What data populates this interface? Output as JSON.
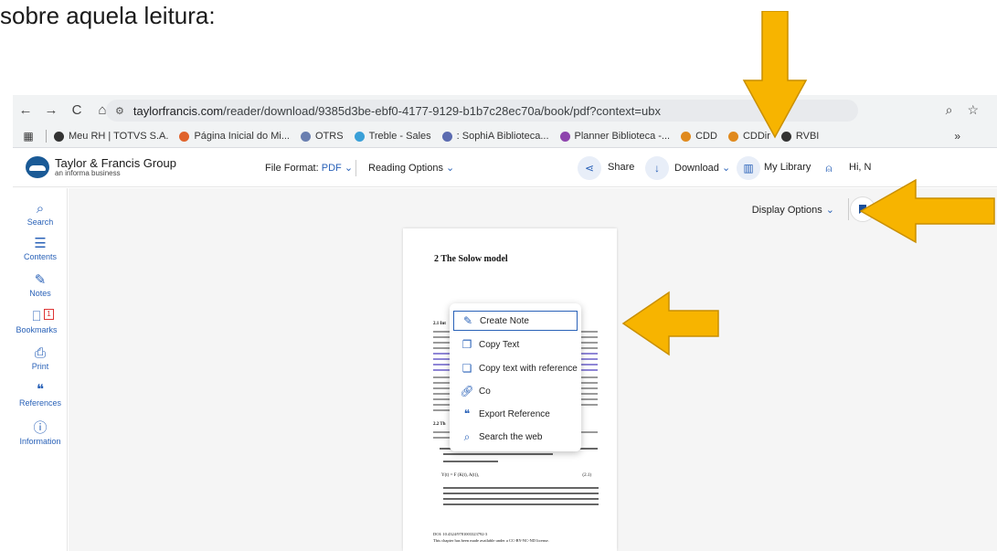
{
  "caption": "sobre aquela leitura:",
  "browser": {
    "url_host": "taylorfrancis.com",
    "url_path": "/reader/download/9385d3be-ebf0-4177-9129-b1b7c28ec70a/book/pdf?context=ubx",
    "bookmarks": [
      {
        "label": "Meu RH | TOTVS S.A.",
        "color": "#333333"
      },
      {
        "label": "Página Inicial do Mi...",
        "color": "#e0632b"
      },
      {
        "label": "OTRS",
        "color": "#6a7fb0"
      },
      {
        "label": "Treble - Sales",
        "color": "#3aa0d8"
      },
      {
        "label": ": SophiA Biblioteca...",
        "color": "#5b6bb0"
      },
      {
        "label": "Planner Biblioteca -...",
        "color": "#8e44ad"
      },
      {
        "label": "CDD",
        "color": "#e08a1e"
      },
      {
        "label": "CDDir",
        "color": "#e08a1e"
      },
      {
        "label": "RVBI",
        "color": "#333333"
      }
    ],
    "more": "»"
  },
  "header": {
    "brand": "Taylor & Francis Group",
    "brand_sub": "an informa business",
    "file_format_label": "File Format:",
    "file_format_value": "PDF",
    "reading_options": "Reading Options",
    "share": "Share",
    "download": "Download",
    "my_library": "My Library",
    "greeting": "Hi, N"
  },
  "sidebar": {
    "items": [
      {
        "label": "Search",
        "icon": "search-icon"
      },
      {
        "label": "Contents",
        "icon": "list-icon"
      },
      {
        "label": "Notes",
        "icon": "note-icon"
      },
      {
        "label": "Bookmarks",
        "icon": "bookmark-icon",
        "badge": "1"
      },
      {
        "label": "Print",
        "icon": "print-icon"
      },
      {
        "label": "References",
        "icon": "quote-icon"
      },
      {
        "label": "Information",
        "icon": "info-icon"
      }
    ]
  },
  "toolbar": {
    "display_options": "Display Options"
  },
  "pdf": {
    "chapter_title": "2   The Solow model",
    "section_1": "2.1  Int",
    "section_2": "2.2  Th",
    "equation": "Y(t) = F (K(t), A(t)),",
    "equation_number": "(2.1)",
    "doi": "DOI: 10.4324/9781003323792-3",
    "license": "This chapter has been made available under a CC-BY-NC-ND license."
  },
  "context_menu": {
    "items": [
      {
        "label": "Create Note",
        "icon": "edit-note-icon"
      },
      {
        "label": "Copy Text",
        "icon": "copy-icon"
      },
      {
        "label": "Copy text with reference",
        "icon": "copy-reference-icon"
      },
      {
        "label": "Co",
        "icon": "link-icon"
      },
      {
        "label": "Export Reference",
        "icon": "quote-icon"
      },
      {
        "label": "Search the web",
        "icon": "search-icon"
      }
    ]
  },
  "colors": {
    "accent": "#2a62b8",
    "arrow_fill": "#f7b400",
    "arrow_stroke": "#c98f00",
    "highlight": "#8f86d6"
  }
}
